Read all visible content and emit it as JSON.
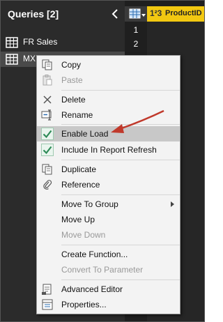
{
  "queries": {
    "title": "Queries [2]",
    "items": [
      {
        "label": "FR Sales"
      },
      {
        "label": "MX"
      }
    ]
  },
  "grid": {
    "column_type": "1²3",
    "column_header": "ProductID",
    "row_numbers": [
      "1",
      "2"
    ]
  },
  "menu": {
    "copy": "Copy",
    "paste": "Paste",
    "delete": "Delete",
    "rename": "Rename",
    "enable_load": "Enable Load",
    "include_refresh": "Include In Report Refresh",
    "duplicate": "Duplicate",
    "reference": "Reference",
    "move_to_group": "Move To Group",
    "move_up": "Move Up",
    "move_down": "Move Down",
    "create_function": "Create Function...",
    "convert_to_parameter": "Convert To Parameter",
    "advanced_editor": "Advanced Editor",
    "properties": "Properties..."
  },
  "colors": {
    "accent": "#f2c811",
    "check": "#2e8b57",
    "annotation_arrow": "#c0392b"
  }
}
